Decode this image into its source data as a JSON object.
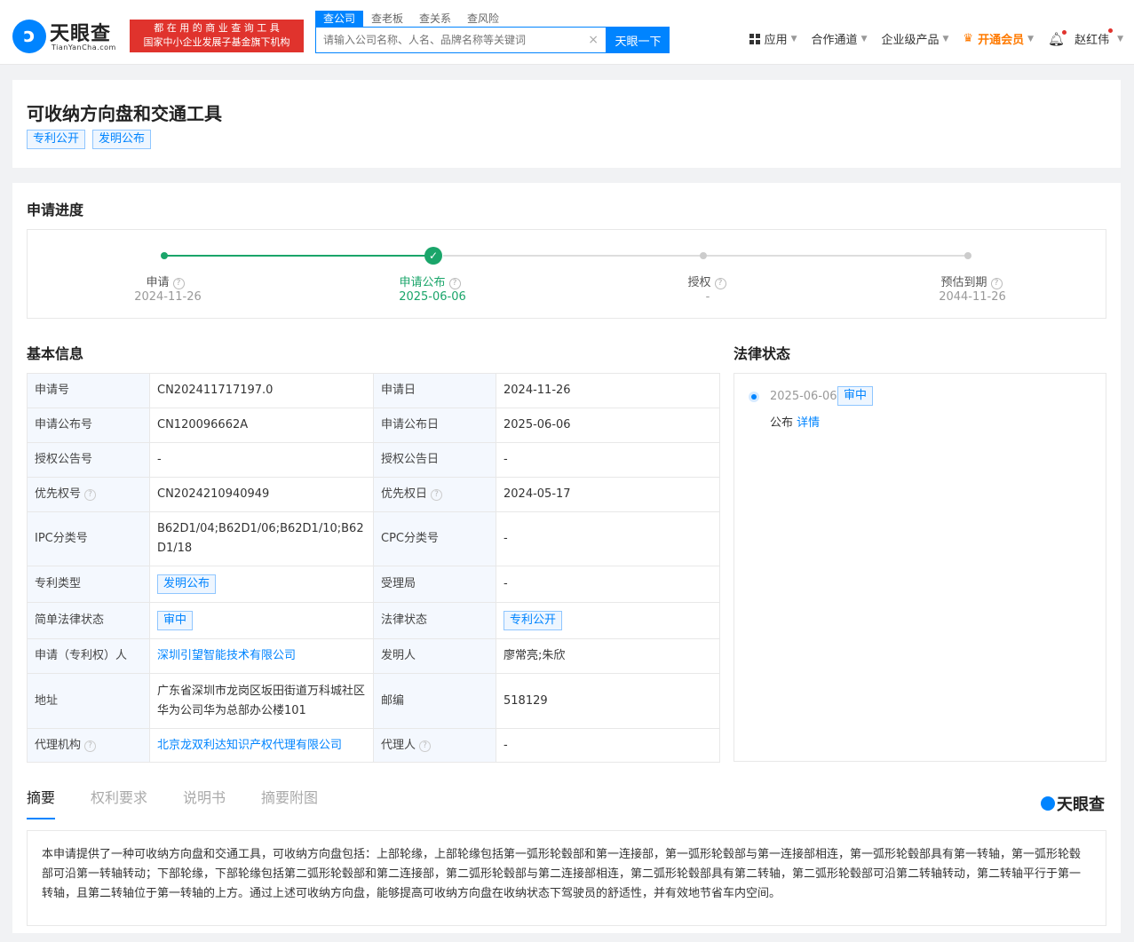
{
  "header": {
    "logo_cn": "天眼查",
    "logo_en": "TianYanCha.com",
    "slogan_line1": "都 在 用 的 商 业 查 询 工 具",
    "slogan_line2": "国家中小企业发展子基金旗下机构",
    "search_tabs": [
      "查公司",
      "查老板",
      "查关系",
      "查风险"
    ],
    "search_placeholder": "请输入公司名称、人名、品牌名称等关键词",
    "search_button": "天眼一下",
    "nav": {
      "apps": "应用",
      "cooperation": "合作通道",
      "enterprise": "企业级产品",
      "vip": "开通会员",
      "user": "赵红伟"
    }
  },
  "patent": {
    "title": "可收纳方向盘和交通工具",
    "tags": [
      "专利公开",
      "发明公布"
    ]
  },
  "progress": {
    "title": "申请进度",
    "steps": [
      {
        "label": "申请",
        "date": "2024-11-26"
      },
      {
        "label": "申请公布",
        "date": "2025-06-06"
      },
      {
        "label": "授权",
        "date": "-"
      },
      {
        "label": "预估到期",
        "date": "2044-11-26"
      }
    ]
  },
  "basic_info": {
    "title": "基本信息",
    "rows": [
      {
        "k1": "申请号",
        "v1": "CN202411717197.0",
        "k2": "申请日",
        "v2": "2024-11-26"
      },
      {
        "k1": "申请公布号",
        "v1": "CN120096662A",
        "k2": "申请公布日",
        "v2": "2025-06-06"
      },
      {
        "k1": "授权公告号",
        "v1": "-",
        "k2": "授权公告日",
        "v2": "-"
      },
      {
        "k1": "优先权号",
        "v1": "CN2024210940949",
        "k2": "优先权日",
        "v2": "2024-05-17"
      },
      {
        "k1": "IPC分类号",
        "v1": "B62D1/04;B62D1/06;B62D1/10;B62D1/18",
        "k2": "CPC分类号",
        "v2": "-"
      },
      {
        "k1": "专利类型",
        "v1": "发明公布",
        "k2": "受理局",
        "v2": "-"
      },
      {
        "k1": "简单法律状态",
        "v1": "审中",
        "k2": "法律状态",
        "v2": "专利公开"
      },
      {
        "k1": "申请（专利权）人",
        "v1": "深圳引望智能技术有限公司",
        "k2": "发明人",
        "v2": "廖常亮;朱欣"
      },
      {
        "k1": "地址",
        "v1": "广东省深圳市龙岗区坂田街道万科城社区华为公司华为总部办公楼101",
        "k2": "邮编",
        "v2": "518129"
      },
      {
        "k1": "代理机构",
        "v1": "北京龙双利达知识产权代理有限公司",
        "k2": "代理人",
        "v2": "-"
      }
    ]
  },
  "legal_status": {
    "title": "法律状态",
    "date": "2025-06-06",
    "tag": "审中",
    "text": "公布",
    "link": "详情"
  },
  "detail_tabs": [
    "摘要",
    "权利要求",
    "说明书",
    "摘要附图"
  ],
  "brand_mark": "天眼查",
  "abstract": "本申请提供了一种可收纳方向盘和交通工具，可收纳方向盘包括：上部轮缘，上部轮缘包括第一弧形轮毂部和第一连接部，第一弧形轮毂部与第一连接部相连，第一弧形轮毂部具有第一转轴，第一弧形轮毂部可沿第一转轴转动；下部轮缘，下部轮缘包括第二弧形轮毂部和第二连接部，第二弧形轮毂部与第二连接部相连，第二弧形轮毂部具有第二转轴，第二弧形轮毂部可沿第二转轴转动，第二转轴平行于第一转轴，且第二转轴位于第一转轴的上方。通过上述可收纳方向盘，能够提高可收纳方向盘在收纳状态下驾驶员的舒适性，并有效地节省车内空间。"
}
